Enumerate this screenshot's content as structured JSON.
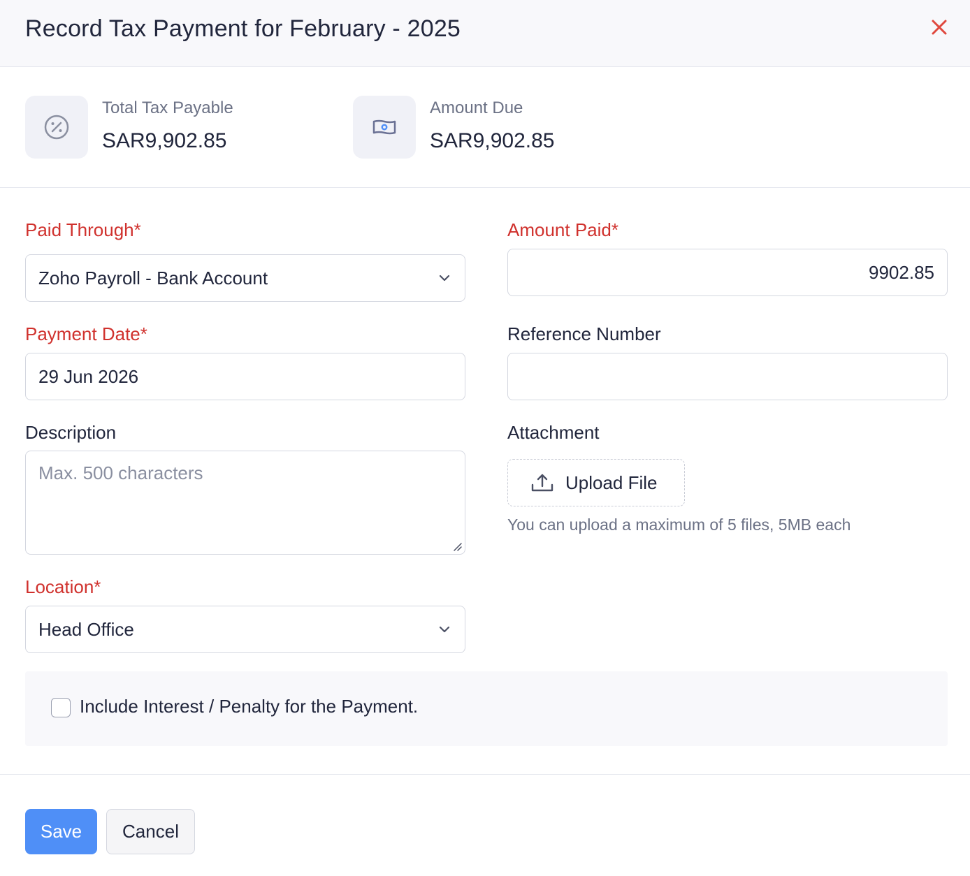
{
  "header": {
    "title": "Record Tax Payment for February - 2025"
  },
  "summary": {
    "total_tax_payable": {
      "label": "Total Tax Payable",
      "value": "SAR9,902.85"
    },
    "amount_due": {
      "label": "Amount Due",
      "value": "SAR9,902.85"
    }
  },
  "form": {
    "paid_through": {
      "label": "Paid Through*",
      "value": "Zoho Payroll - Bank Account"
    },
    "amount_paid": {
      "label": "Amount Paid*",
      "value": "9902.85"
    },
    "payment_date": {
      "label": "Payment Date*",
      "value": "29 Jun 2026"
    },
    "reference_number": {
      "label": "Reference Number",
      "value": ""
    },
    "description": {
      "label": "Description",
      "placeholder": "Max. 500 characters"
    },
    "attachment": {
      "label": "Attachment",
      "button_label": "Upload File",
      "hint": "You can upload a maximum of 5 files, 5MB each"
    },
    "location": {
      "label": "Location*",
      "value": "Head Office"
    },
    "penalty": {
      "label": "Include Interest / Penalty for the Payment.",
      "checked": false
    }
  },
  "footer": {
    "save_label": "Save",
    "cancel_label": "Cancel"
  },
  "colors": {
    "accent": "#4f8ff7",
    "required": "#d0312d",
    "close": "#e0483e"
  }
}
